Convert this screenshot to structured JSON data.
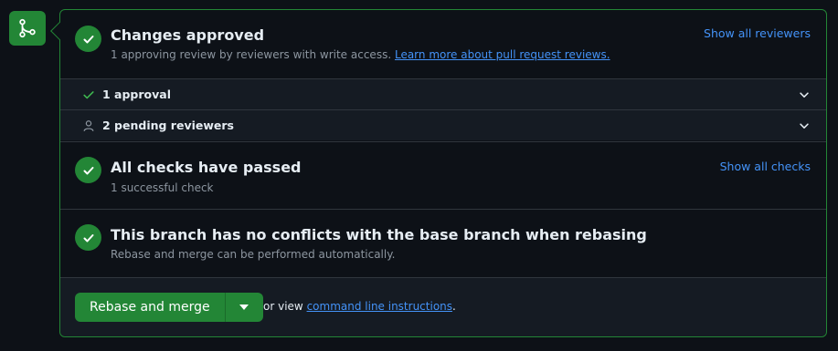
{
  "merge_badge": {
    "icon": "git-merge-icon",
    "color": "#238636"
  },
  "reviews": {
    "title": "Changes approved",
    "subtitle": "1 approving review by reviewers with write access.",
    "learn_more_link": "Learn more about pull request reviews.",
    "show_all_link": "Show all reviewers",
    "rows": [
      {
        "icon": "check-icon",
        "label": "1 approval"
      },
      {
        "icon": "person-icon",
        "label": "2 pending reviewers"
      }
    ]
  },
  "checks": {
    "title": "All checks have passed",
    "subtitle": "1 successful check",
    "show_all_link": "Show all checks"
  },
  "conflicts": {
    "title": "This branch has no conflicts with the base branch when rebasing",
    "subtitle": "Rebase and merge can be performed automatically."
  },
  "footer": {
    "merge_button": "Rebase and merge",
    "or_view_text": "or view",
    "cli_link": "command line instructions",
    "trailing": "."
  },
  "colors": {
    "accent_green": "#238636",
    "link_blue": "#4493f8",
    "background": "#0d1117"
  }
}
